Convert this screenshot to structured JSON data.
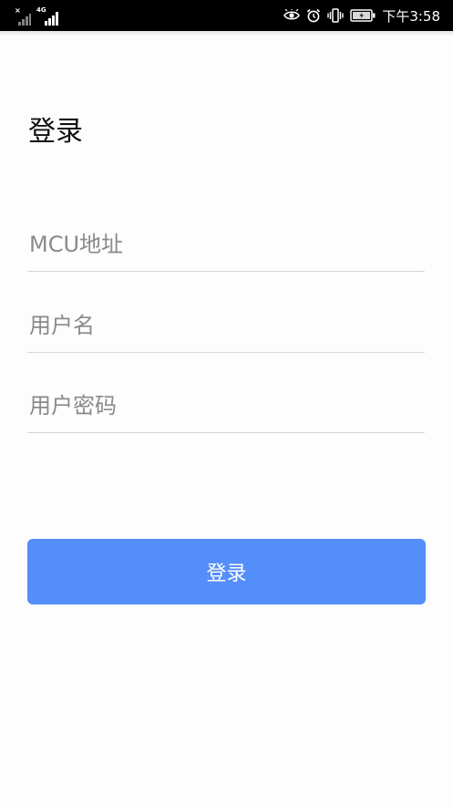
{
  "status_bar": {
    "time": "下午3:58",
    "network_type": "4G",
    "icons": [
      "signal-no-service-icon",
      "signal-4g-icon",
      "eye-icon",
      "alarm-icon",
      "vibrate-icon",
      "battery-charging-icon"
    ]
  },
  "page": {
    "title": "登录"
  },
  "form": {
    "mcu_placeholder": "MCU地址",
    "mcu_value": "",
    "username_placeholder": "用户名",
    "username_value": "",
    "password_placeholder": "用户密码",
    "password_value": ""
  },
  "actions": {
    "login_label": "登录"
  },
  "colors": {
    "accent": "#548efa",
    "status_bar": "#000000",
    "background": "#fdfdfd",
    "divider": "#d6d6d6"
  }
}
